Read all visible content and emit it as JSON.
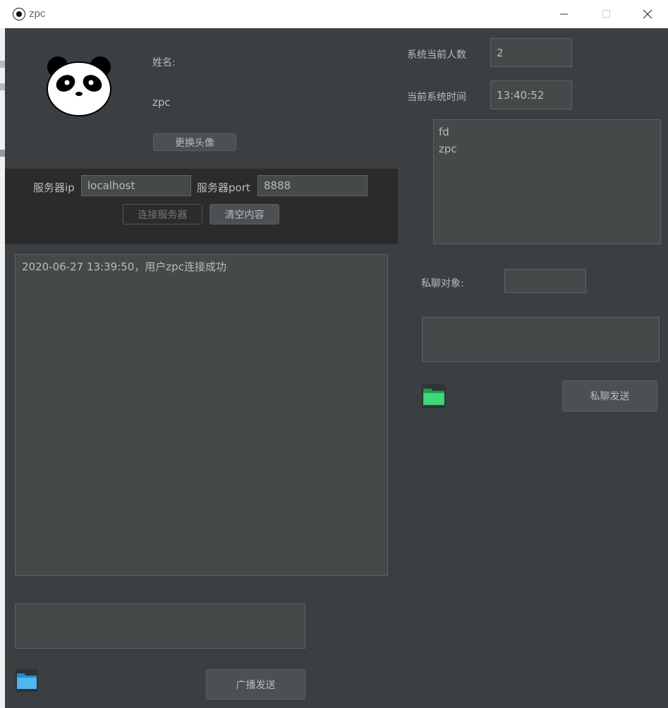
{
  "window": {
    "title": "zpc"
  },
  "profile": {
    "name_label": "姓名:",
    "name_value": "zpc",
    "change_avatar_label": "更换头像"
  },
  "server": {
    "ip_label": "服务器ip",
    "ip_value": "localhost",
    "port_label": "服务器port",
    "port_value": "8888",
    "connect_label": "连接服务器",
    "clear_label": "清空内容"
  },
  "log": {
    "lines": [
      "2020-06-27 13:39:50，用户zpc连接成功"
    ]
  },
  "broadcast": {
    "send_label": "广播发送",
    "input_value": ""
  },
  "system": {
    "count_label": "系统当前人数",
    "count_value": "2",
    "time_label": "当前系统时间",
    "time_value": "13:40:52"
  },
  "users": [
    "fd",
    "zpc"
  ],
  "private_chat": {
    "target_label": "私聊对象:",
    "target_value": "",
    "message_value": "",
    "send_label": "私聊发送"
  },
  "colors": {
    "background": "#3c3f41",
    "panel_dark": "#2b2b2b",
    "field": "#45494a",
    "text": "#bbbbbb"
  }
}
